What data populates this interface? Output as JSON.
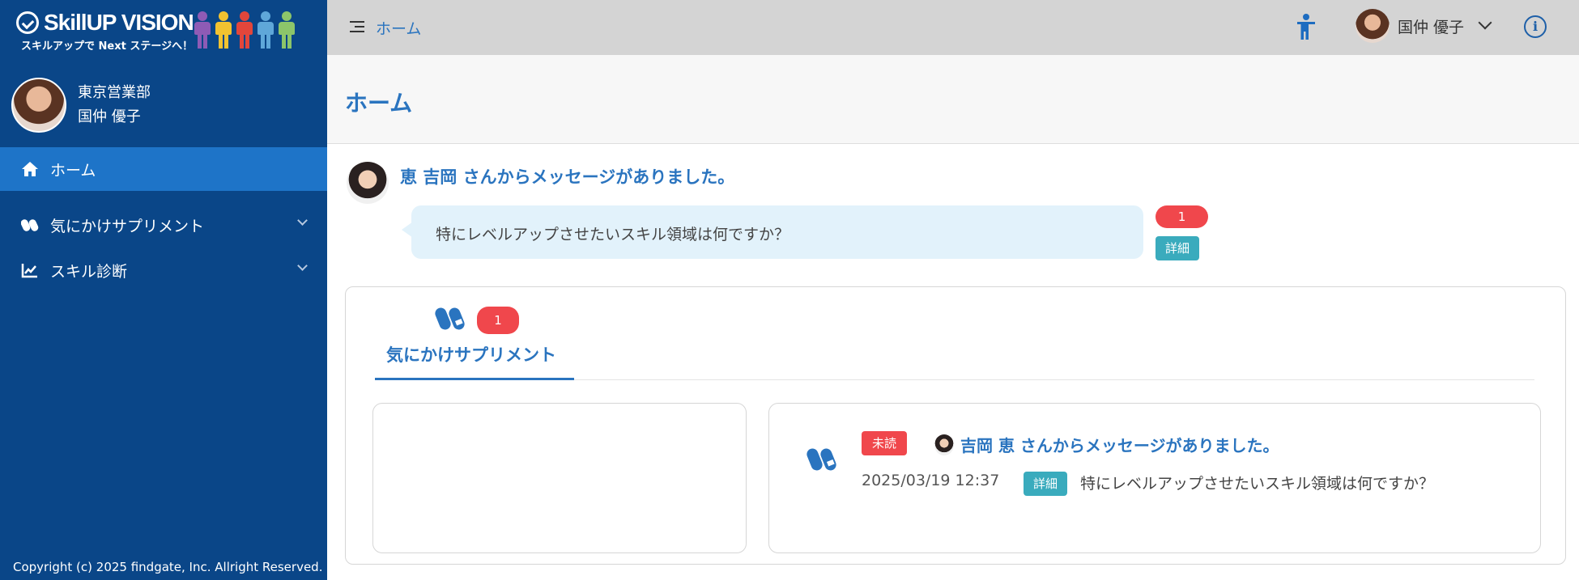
{
  "brand": {
    "name": "SkillUP VISION",
    "tagline": "スキルアップで Next ステージへ！"
  },
  "sidebar": {
    "department": "東京営業部",
    "user_name": "国仲 優子",
    "items": [
      {
        "label": "ホーム",
        "icon": "home-icon",
        "active": true
      },
      {
        "label": "気にかけサプリメント",
        "icon": "pills-icon",
        "expandable": true
      },
      {
        "label": "スキル診断",
        "icon": "chart-icon",
        "expandable": true
      }
    ],
    "copyright": "Copyright (c) 2025 findgate, Inc. Allright Reserved."
  },
  "topbar": {
    "breadcrumb": "ホーム",
    "user_name": "国仲 優子",
    "info_glyph": "i"
  },
  "page": {
    "title": "ホーム"
  },
  "message": {
    "title": "恵 吉岡 さんからメッセージがありました。",
    "text": "特にレベルアップさせたいスキル領域は何ですか？",
    "count": "1",
    "detail_label": "詳細"
  },
  "supplement": {
    "tab_label": "気にかけサプリメント",
    "tab_count": "1",
    "item": {
      "status": "未読",
      "title": "吉岡 恵  さんからメッセージがありました。",
      "date": "2025/03/19 12:37",
      "detail_label": "詳細",
      "text": "特にレベルアップさせたいスキル領域は何ですか？"
    }
  },
  "colors": {
    "sidebar_bg": "#0a4688",
    "active_nav": "#1e74c8",
    "accent": "#2a74bf",
    "badge_red": "#f0474c",
    "detail_teal": "#3aabbd"
  }
}
